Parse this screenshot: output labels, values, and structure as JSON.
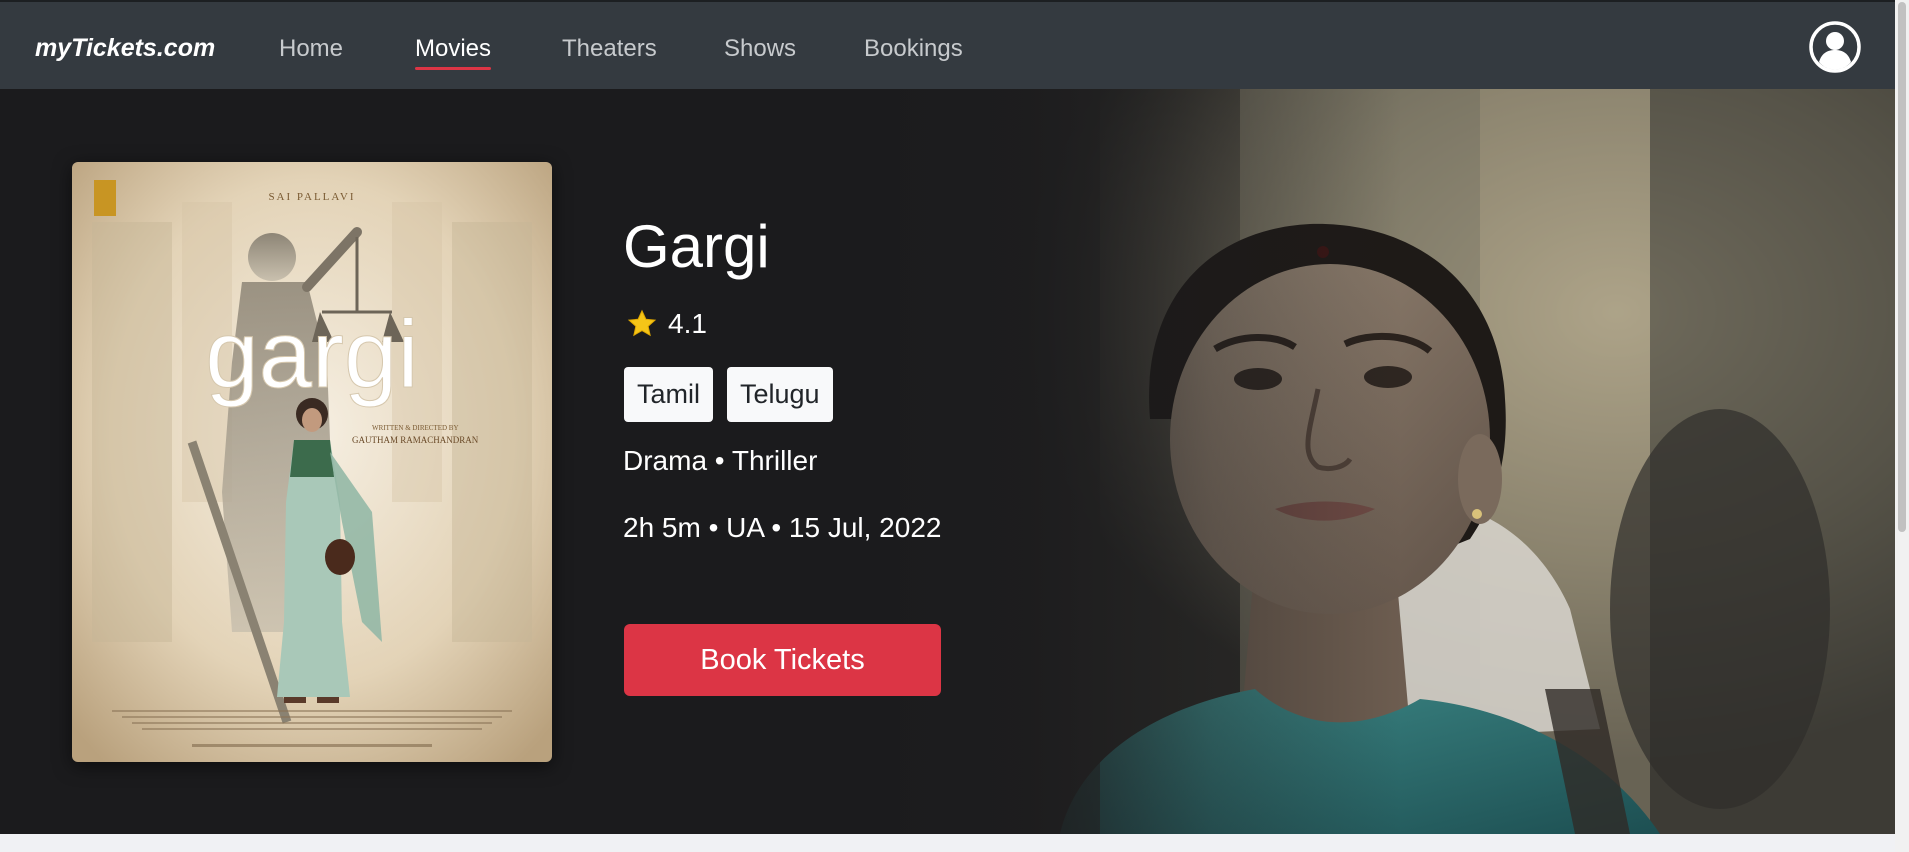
{
  "navbar": {
    "brand": "myTickets.com",
    "links": [
      {
        "label": "Home",
        "active": false
      },
      {
        "label": "Movies",
        "active": true
      },
      {
        "label": "Theaters",
        "active": false
      },
      {
        "label": "Shows",
        "active": false
      },
      {
        "label": "Bookings",
        "active": false
      }
    ],
    "profile_icon": "user-circle-icon"
  },
  "movie": {
    "title": "Gargi",
    "rating": "4.1",
    "rating_icon": "star-icon",
    "languages": [
      "Tamil",
      "Telugu"
    ],
    "genres": "Drama • Thriller",
    "details": "2h 5m • UA • 15 Jul, 2022",
    "book_label": "Book Tickets"
  },
  "poster": {
    "actor_credit": "SAI PALLAVI",
    "logo_text": "gargi",
    "director_credit_line1": "WRITTEN & DIRECTED BY",
    "director_credit_line2": "GAUTHAM RAMACHANDRAN"
  },
  "colors": {
    "navbar_bg": "#343a40",
    "hero_bg": "#1b1b1d",
    "accent": "#dc3545",
    "star": "#f5c518",
    "badge_bg": "#f8f9fa"
  }
}
